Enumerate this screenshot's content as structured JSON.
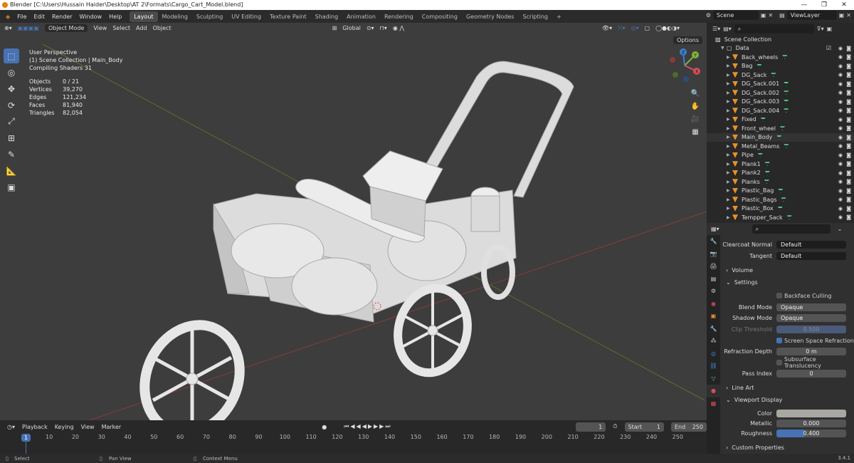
{
  "titlebar": {
    "title": "Blender [C:\\Users\\Hussain Haider\\Desktop\\AT 2\\Formats\\Cargo_Cart_Model.blend]",
    "minimize": "—",
    "maximize": "❐",
    "close": "✕"
  },
  "menu": [
    "File",
    "Edit",
    "Render",
    "Window",
    "Help"
  ],
  "workspaces": [
    "Layout",
    "Modeling",
    "Sculpting",
    "UV Editing",
    "Texture Paint",
    "Shading",
    "Animation",
    "Rendering",
    "Compositing",
    "Geometry Nodes",
    "Scripting",
    "+"
  ],
  "scene": {
    "name": "Scene",
    "view_layer": "ViewLayer"
  },
  "viewport": {
    "mode": "Object Mode",
    "menus": [
      "View",
      "Select",
      "Add",
      "Object"
    ],
    "orientation": "Global",
    "options": "Options",
    "overlay_title": "User Perspective",
    "overlay_collection": "(1) Scene Collection | Main_Body",
    "overlay_status": "Compiling Shaders 31",
    "stats": [
      {
        "k": "Objects",
        "v": "0 / 21"
      },
      {
        "k": "Vertices",
        "v": "39,270"
      },
      {
        "k": "Edges",
        "v": "121,234"
      },
      {
        "k": "Faces",
        "v": "81,940"
      },
      {
        "k": "Triangles",
        "v": "82,054"
      }
    ],
    "gizmo": {
      "x": "X",
      "y": "Y",
      "z": "Z"
    }
  },
  "timeline": {
    "menus": [
      "Playback",
      "Keying",
      "View",
      "Marker"
    ],
    "current": "1",
    "start_label": "Start",
    "start": "1",
    "end_label": "End",
    "end": "250",
    "ticks": [
      "1",
      "10",
      "20",
      "30",
      "40",
      "50",
      "60",
      "70",
      "80",
      "90",
      "100",
      "110",
      "120",
      "130",
      "140",
      "150",
      "160",
      "170",
      "180",
      "190",
      "200",
      "210",
      "220",
      "230",
      "240",
      "250"
    ]
  },
  "statusbar": {
    "select": "Select",
    "pan": "Pan View",
    "context": "Context Menu",
    "version": "3.4.1"
  },
  "outliner": {
    "root": "Scene Collection",
    "collection": "Data",
    "items": [
      "Back_wheels",
      "Bag",
      "DG_Sack",
      "DG_Sack.001",
      "DG_Sack.002",
      "DG_Sack.003",
      "DG_Sack.004",
      "Fixed",
      "Front_wheel",
      "Main_Body",
      "Metal_Beams",
      "Pipe",
      "Plank1",
      "Plank2",
      "Planks",
      "Plastic_Bag",
      "Plastic_Bags",
      "Plastic_Box",
      "Tempper_Sack"
    ]
  },
  "properties": {
    "clearcoat_normal_label": "Clearcoat Normal",
    "clearcoat_normal": "Default",
    "tangent_label": "Tangent",
    "tangent": "Default",
    "volume": "Volume",
    "settings": "Settings",
    "backface": "Backface Culling",
    "blend_mode_label": "Blend Mode",
    "blend_mode": "Opaque",
    "shadow_mode_label": "Shadow Mode",
    "shadow_mode": "Opaque",
    "clip_label": "Clip Threshold",
    "clip": "0.500",
    "ssr": "Screen Space Refraction",
    "refraction_label": "Refraction Depth",
    "refraction": "0 m",
    "subsurface": "Subsurface Translucency",
    "pass_label": "Pass Index",
    "pass": "0",
    "line_art": "Line Art",
    "viewport_display": "Viewport Display",
    "color_label": "Color",
    "metallic_label": "Metallic",
    "metallic": "0.000",
    "roughness_label": "Roughness",
    "roughness": "0.400",
    "roughness_value": 0.4,
    "custom": "Custom Properties"
  }
}
